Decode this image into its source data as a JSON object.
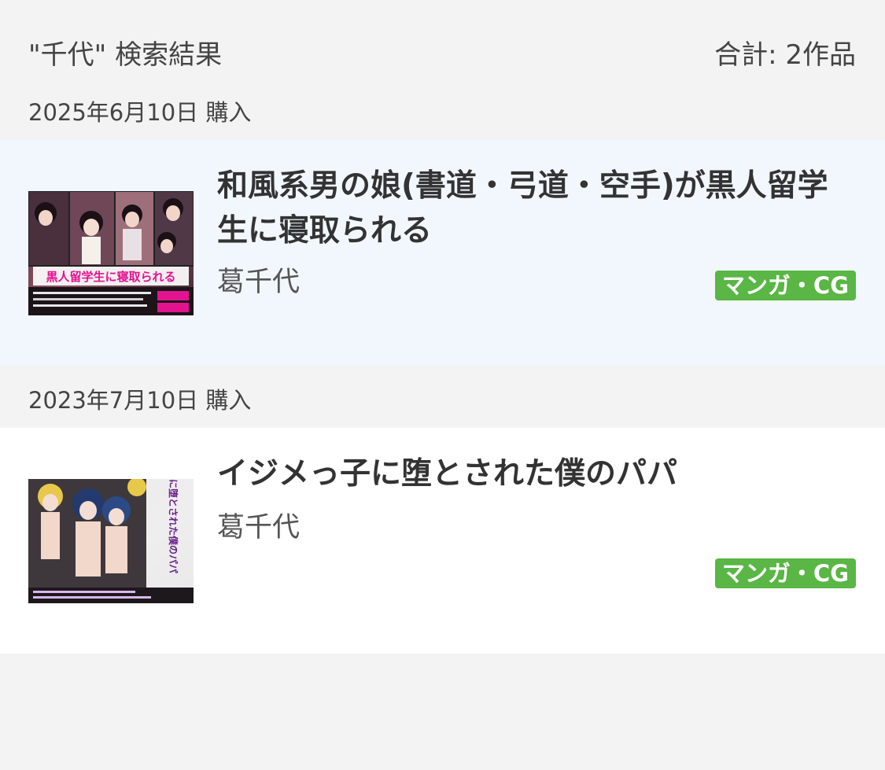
{
  "header": {
    "search_title": "\"千代\" 検索結果",
    "total": "合計: 2作品"
  },
  "purchases": [
    {
      "date_label": "2025年6月10日 購入",
      "title": "和風系男の娘(書道・弓道・空手)が黒人留学生に寝取られる",
      "author": "葛千代",
      "category": "マンガ・CG",
      "thumbnail_caption": "黒人留学生に寝取られる",
      "thumbnail_alt": "和風系男の娘(書道・弓道・空手)が黒人留学生に寝取られる"
    },
    {
      "date_label": "2023年7月10日 購入",
      "title": "イジメっ子に堕とされた僕のパパ",
      "author": "葛千代",
      "category": "マンガ・CG",
      "thumbnail_caption": "イジメっ子に堕とされた僕のパパ",
      "thumbnail_alt": "イジメっ子に堕とされた僕のパパ"
    }
  ],
  "colors": {
    "badge_green": "#5ab645",
    "highlight_row": "#f1f7fc",
    "page_background": "#f3f3f3"
  }
}
